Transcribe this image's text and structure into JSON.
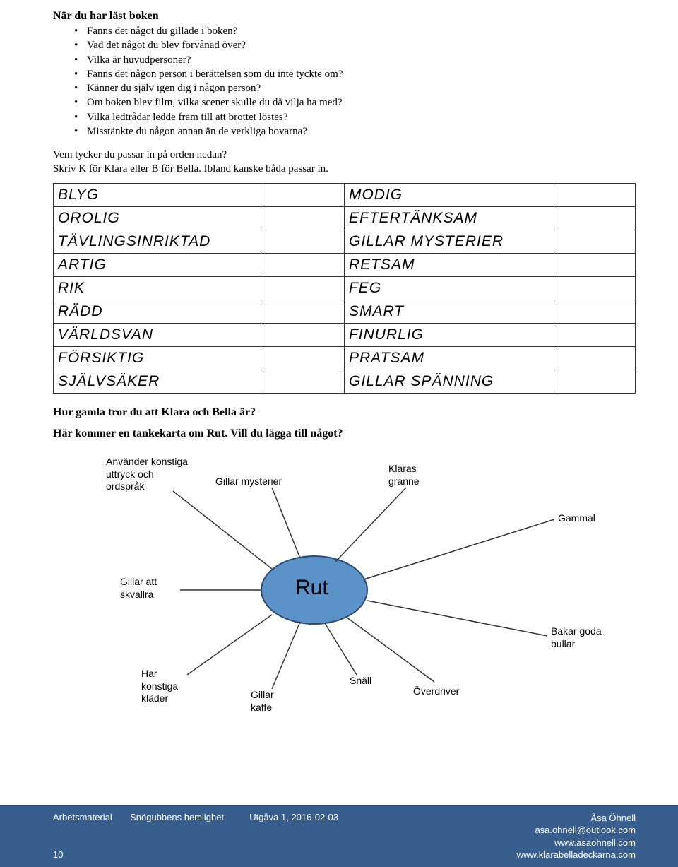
{
  "heading": "När du har läst boken",
  "bullets": [
    "Fanns det något du gillade i boken?",
    "Vad det något du blev förvånad över?",
    "Vilka är huvudpersoner?",
    "Fanns det någon person i berättelsen som du inte tyckte om?",
    "Känner du själv igen dig i någon person?",
    "Om boken blev film, vilka scener skulle du då vilja ha med?",
    "Vilka ledtrådar ledde fram till att brottet löstes?",
    "Misstänkte du någon annan än de verkliga bovarna?"
  ],
  "question1": "Vem tycker du passar in på orden nedan?",
  "question2": "Skriv K för Klara eller B för Bella. Ibland kanske båda passar in.",
  "table_rows": [
    {
      "left": "BLYG",
      "right": "MODIG"
    },
    {
      "left": "OROLIG",
      "right": "EFTERTÄNKSAM"
    },
    {
      "left": "TÄVLINGSINRIKTAD",
      "right": "GILLAR MYSTERIER"
    },
    {
      "left": "ARTIG",
      "right": "RETSAM"
    },
    {
      "left": "RIK",
      "right": "FEG"
    },
    {
      "left": "RÄDD",
      "right": "SMART"
    },
    {
      "left": "VÄRLDSVAN",
      "right": "FINURLIG"
    },
    {
      "left": "FÖRSIKTIG",
      "right": "PRATSAM"
    },
    {
      "left": "SJÄLVSÄKER",
      "right": "GILLAR SPÄNNING"
    }
  ],
  "age_q": "Hur gamla tror du att Klara och Bella är?",
  "mindmap_intro": "Här kommer en tankekarta om Rut. Vill du lägga till något?",
  "mindmap": {
    "center": "Rut",
    "labels": {
      "expr": "Använder konstiga\nuttryck och\nordspråk",
      "myst": "Gillar mysterier",
      "granne": "Klaras\ngranne",
      "gammal": "Gammal",
      "skvallra": "Gillar att\nskvallra",
      "bullar": "Bakar goda\nbullar",
      "klader": "Har\nkonstiga\nkläder",
      "kaffe": "Gillar\nkaffe",
      "snall": "Snäll",
      "overdriver": "Överdriver"
    }
  },
  "footer": {
    "left": "Arbetsmaterial       Snögubbens hemlighet          Utgåva 1, 2016-02-03",
    "author": "Åsa Öhnell",
    "email": "asa.ohnell@outlook.com",
    "url1": "www.asaohnell.com",
    "url2": "www.klarabelladeckarna.com",
    "page": "10"
  }
}
